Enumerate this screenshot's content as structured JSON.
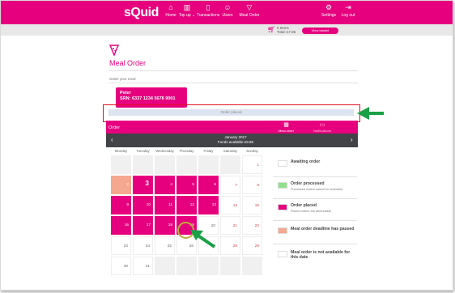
{
  "header": {
    "logo": "sQuid",
    "nav": [
      {
        "label": "Home",
        "icon": "home-icon",
        "glyph": "⌂"
      },
      {
        "label": "Top up ⌄",
        "icon": "topup-icon",
        "glyph": "▥"
      },
      {
        "label": "Transactions",
        "icon": "receipt-icon",
        "glyph": "▯"
      },
      {
        "label": "Users",
        "icon": "users-icon",
        "glyph": "☺"
      },
      {
        "label": "Meal Order",
        "icon": "meal-icon",
        "glyph": "▽"
      }
    ],
    "settings": {
      "label": "Settings",
      "glyph": "⚙"
    },
    "logout": {
      "label": "Log out",
      "glyph": "⇥"
    }
  },
  "basket": {
    "items": "0 Items",
    "total": "Total: £7.85",
    "button": "View basket"
  },
  "page": {
    "title": "Meal Order",
    "subtitle": "Order your meal"
  },
  "student": {
    "name": "Peter",
    "srn": "SRN: 6337 1234 5678 9001"
  },
  "order_placed_bar": "Order placed",
  "order_bar": {
    "label": "Order",
    "tab_meals": "Meal order",
    "tab_other": "Notifications"
  },
  "calendar": {
    "month": "January 2017",
    "subtitle": "Funds available £9.85",
    "weekdays": [
      "Monday",
      "Tuesday",
      "Wednesday",
      "Thursday",
      "Friday",
      "Saturday",
      "Sunday"
    ],
    "rows": [
      [
        "",
        "",
        "",
        "",
        "",
        "",
        "1"
      ],
      [
        "2",
        "3",
        "4",
        "5",
        "6",
        "7",
        "8"
      ],
      [
        "9",
        "10",
        "11",
        "12",
        "13",
        "14",
        "15"
      ],
      [
        "16",
        "17",
        "18",
        "19",
        "20",
        "21",
        "22"
      ],
      [
        "23",
        "24",
        "25",
        "26",
        "27",
        "28",
        "29"
      ],
      [
        "30",
        "31",
        "",
        "",
        "",
        "",
        ""
      ]
    ]
  },
  "legend": [
    {
      "title": "Awaiting order",
      "sub": "",
      "color": "#ffffff"
    },
    {
      "title": "Order processed",
      "sub": "Processed orders cannot be amended",
      "color": "#8fe08a"
    },
    {
      "title": "Order placed",
      "sub": "Placed orders are amendable",
      "color": "#e6007e"
    },
    {
      "title": "Meal order deadline has passed",
      "sub": "",
      "color": "#f5a78f"
    },
    {
      "title": "Meal order is not available for this date",
      "sub": "",
      "color": "#ffffff"
    }
  ],
  "colors": {
    "brand": "#e6007e",
    "deadline": "#f5a78f",
    "processed": "#8fe08a",
    "annotation_arrow": "#1aa046"
  }
}
